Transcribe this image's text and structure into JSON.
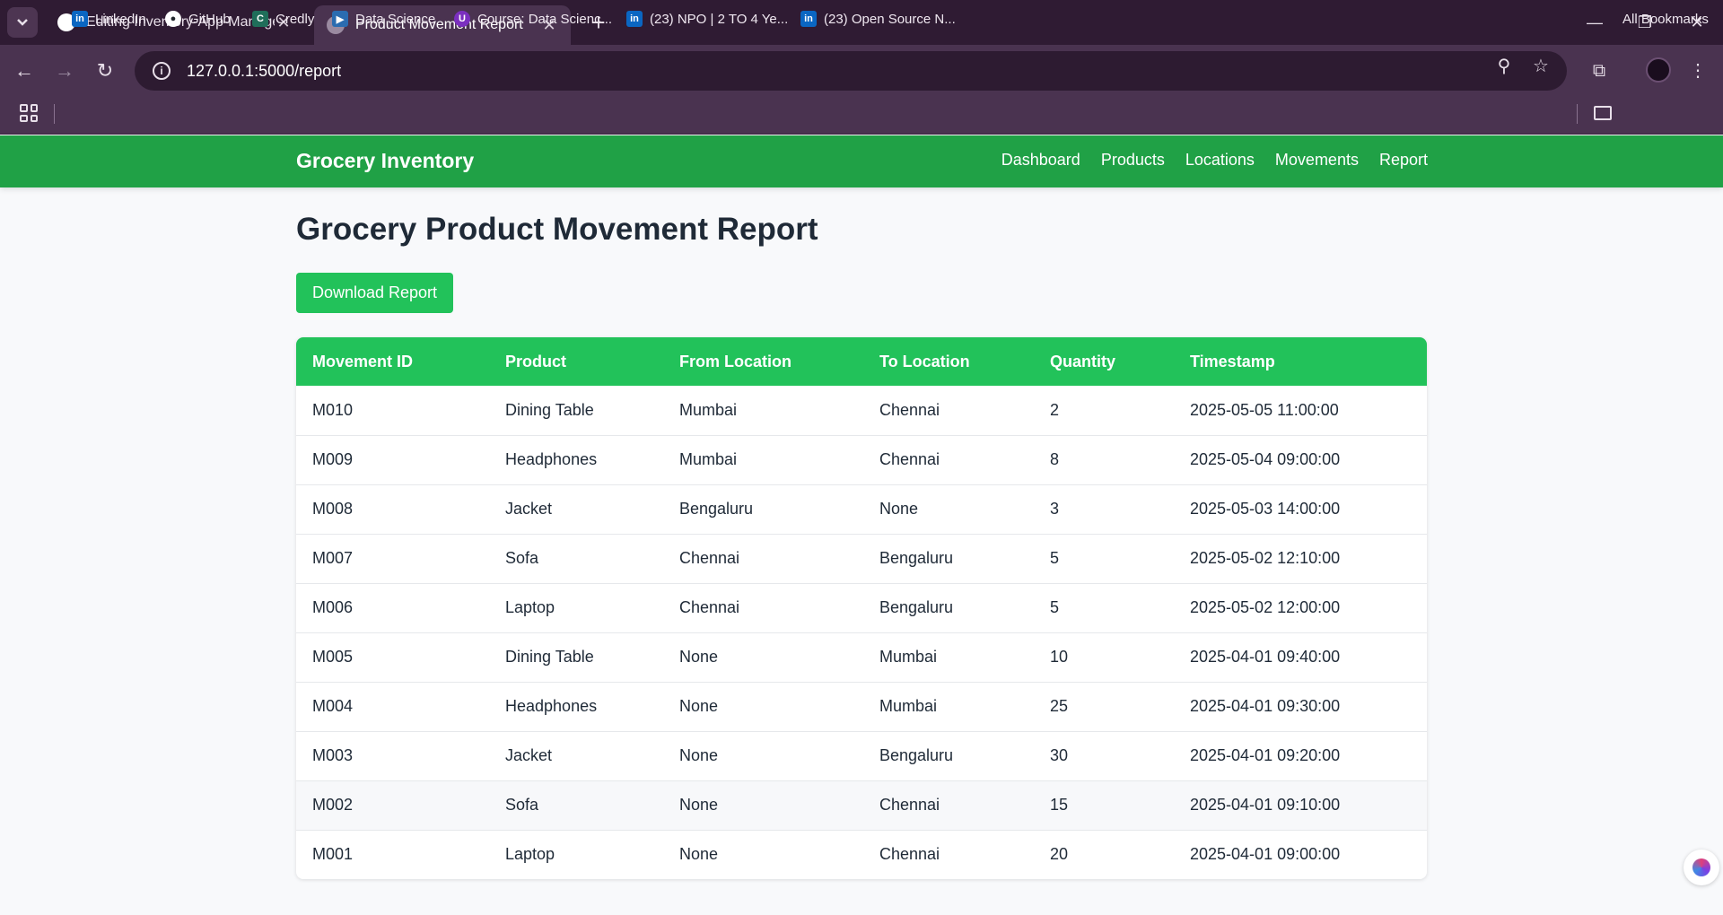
{
  "browser": {
    "tabs": [
      {
        "title": "Editing Inventory-App-Manage",
        "active": false
      },
      {
        "title": "Product Movement Report",
        "active": true
      }
    ],
    "url": "127.0.0.1:5000/report",
    "bookmarks": [
      {
        "label": "LinkedIn",
        "icon": "linkedin-icon"
      },
      {
        "label": "GitHub",
        "icon": "github-icon"
      },
      {
        "label": "Credly",
        "icon": "credly-icon"
      },
      {
        "label": "Data Science",
        "icon": "video-icon"
      },
      {
        "label": "Course: Data Scienc...",
        "icon": "course-icon"
      },
      {
        "label": "(23) NPO | 2 TO 4 Ye...",
        "icon": "linkedin-icon"
      },
      {
        "label": "(23) Open Source N...",
        "icon": "linkedin-icon"
      }
    ],
    "all_bookmarks": "All Bookmarks"
  },
  "app": {
    "brand": "Grocery Inventory",
    "nav": [
      "Dashboard",
      "Products",
      "Locations",
      "Movements",
      "Report"
    ],
    "accent_color": "#22c25a"
  },
  "page": {
    "title": "Grocery Product Movement Report",
    "download_label": "Download Report"
  },
  "table": {
    "headers": [
      "Movement ID",
      "Product",
      "From Location",
      "To Location",
      "Quantity",
      "Timestamp"
    ],
    "rows": [
      [
        "M010",
        "Dining Table",
        "Mumbai",
        "Chennai",
        "2",
        "2025-05-05 11:00:00"
      ],
      [
        "M009",
        "Headphones",
        "Mumbai",
        "Chennai",
        "8",
        "2025-05-04 09:00:00"
      ],
      [
        "M008",
        "Jacket",
        "Bengaluru",
        "None",
        "3",
        "2025-05-03 14:00:00"
      ],
      [
        "M007",
        "Sofa",
        "Chennai",
        "Bengaluru",
        "5",
        "2025-05-02 12:10:00"
      ],
      [
        "M006",
        "Laptop",
        "Chennai",
        "Bengaluru",
        "5",
        "2025-05-02 12:00:00"
      ],
      [
        "M005",
        "Dining Table",
        "None",
        "Mumbai",
        "10",
        "2025-04-01 09:40:00"
      ],
      [
        "M004",
        "Headphones",
        "None",
        "Mumbai",
        "25",
        "2025-04-01 09:30:00"
      ],
      [
        "M003",
        "Jacket",
        "None",
        "Bengaluru",
        "30",
        "2025-04-01 09:20:00"
      ],
      [
        "M002",
        "Sofa",
        "None",
        "Chennai",
        "15",
        "2025-04-01 09:10:00"
      ],
      [
        "M001",
        "Laptop",
        "None",
        "Chennai",
        "20",
        "2025-04-01 09:00:00"
      ]
    ]
  }
}
